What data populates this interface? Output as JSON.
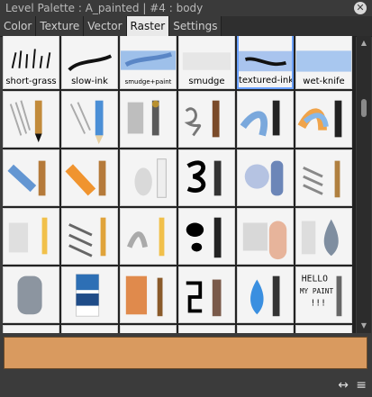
{
  "window": {
    "title": "Level Palette : A_painted | #4 : body",
    "close_glyph": "✕"
  },
  "tabs": [
    "Color",
    "Texture",
    "Vector",
    "Raster",
    "Settings"
  ],
  "active_tab": "Raster",
  "brushes": {
    "row0": [
      {
        "label": "short-grass",
        "icon": "grass-brush-icon"
      },
      {
        "label": "slow-ink",
        "icon": "ink-brush-icon"
      },
      {
        "label": "smudge+paint",
        "icon": "smudge-paint-brush-icon"
      },
      {
        "label": "smudge",
        "icon": "smudge-brush-icon"
      },
      {
        "label": "textured-ink",
        "icon": "textured-ink-brush-icon"
      },
      {
        "label": "wet-knife",
        "icon": "wet-knife-brush-icon"
      }
    ],
    "rows": [
      [
        "pencil-brush-icon",
        "pencil-blue-brush-icon",
        "knife-smudge-brush-icon",
        "scribble-brush-icon",
        "blue-smear-brush-icon",
        "orange-blue-brush-icon"
      ],
      [
        "blue-paint-brush-icon",
        "orange-paint-brush-icon",
        "white-drop-brush-icon",
        "black-swirl-brush-icon",
        "blue-spray-brush-icon",
        "grey-hatch-brush-icon"
      ],
      [
        "light-paint-brush-icon",
        "hatch-brush-icon",
        "wet-brush-icon",
        "black-blot-brush-icon",
        "grain-brush-icon",
        "grey-drop-brush-icon"
      ],
      [
        "grey-blob-brush-icon",
        "eraser-brush-icon",
        "orange-smear-brush-icon",
        "square-stroke-brush-icon",
        "blue-drop-brush-icon",
        "hello-text-brush-icon"
      ],
      [
        "dark-pen-brush-icon",
        "spiral-pen-brush-icon",
        "zigzag-brush-icon",
        "soft-airbrush-icon",
        "pen-nib-brush-icon",
        "gold-texture-brush-icon"
      ]
    ],
    "hello_text": [
      "HELLO",
      "MY PAINT",
      "!!!"
    ],
    "selected_index": 4
  },
  "scrollbar": {
    "up": "▲",
    "down": "▼"
  },
  "current_color": "#d99a5f",
  "footer": {
    "swap_glyph": "↔",
    "menu_glyph": "≡"
  }
}
